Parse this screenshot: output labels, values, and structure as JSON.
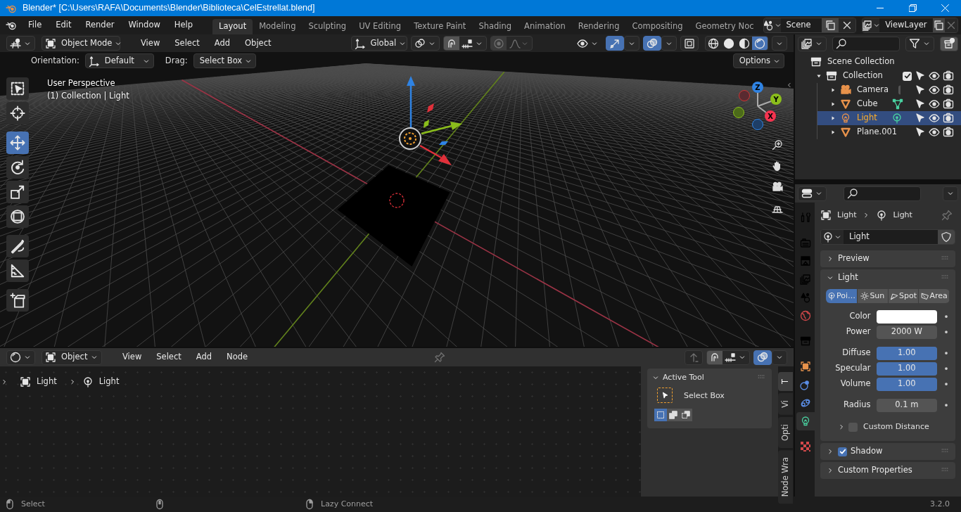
{
  "window": {
    "title": "Blender* [C:\\Users\\RAFA\\Documents\\Blender\\Biblioteca\\CelEstrellat.blend]"
  },
  "menu": [
    "File",
    "Edit",
    "Render",
    "Window",
    "Help"
  ],
  "workspaces": [
    {
      "label": "Layout",
      "selected": true
    },
    {
      "label": "Modeling",
      "selected": false
    },
    {
      "label": "Sculpting",
      "selected": false
    },
    {
      "label": "UV Editing",
      "selected": false
    },
    {
      "label": "Texture Paint",
      "selected": false
    },
    {
      "label": "Shading",
      "selected": false
    },
    {
      "label": "Animation",
      "selected": false
    },
    {
      "label": "Rendering",
      "selected": false
    },
    {
      "label": "Compositing",
      "selected": false
    },
    {
      "label": "Geometry Noc",
      "selected": false
    }
  ],
  "scene": "Scene",
  "view_layer": "ViewLayer",
  "viewport": {
    "mode": "Object Mode",
    "menus": [
      "View",
      "Select",
      "Add",
      "Object"
    ],
    "transform_orientation": "Global",
    "toggles": [
      {
        "kind": "gizmo",
        "on": true
      },
      {
        "kind": "overlay",
        "on": true
      },
      {
        "kind": "xray",
        "on": false
      }
    ],
    "shading": [
      {
        "kind": "wireframe",
        "selected": false
      },
      {
        "kind": "solid",
        "selected": false
      },
      {
        "kind": "material",
        "selected": false
      },
      {
        "kind": "rendered",
        "selected": true
      }
    ],
    "tool_settings": {
      "orientation_label": "Orientation:",
      "orientation": "Default",
      "drag_label": "Drag:",
      "drag": "Select Box",
      "options": "Options"
    },
    "overlay_text": [
      "User Perspective",
      "(1) Collection | Light"
    ],
    "tools": [
      {
        "kind": "select_box",
        "selected": false
      },
      {
        "kind": "cursor",
        "selected": false
      },
      {
        "kind": "move",
        "selected": true
      },
      {
        "kind": "rotate",
        "selected": false
      },
      {
        "kind": "scale",
        "selected": false
      },
      {
        "kind": "transform",
        "selected": false
      },
      {
        "kind": "annotate",
        "selected": false
      },
      {
        "kind": "measure",
        "selected": false
      },
      {
        "kind": "add_cube",
        "selected": false
      }
    ],
    "gizmo_axes": [
      "Z",
      "Y",
      "X"
    ]
  },
  "node_editor": {
    "data_type": "Object",
    "menus": [
      "View",
      "Select",
      "Add",
      "Node"
    ],
    "breadcrumb": [
      "Light",
      "Light"
    ],
    "active_tool": {
      "title": "Active Tool",
      "tool": "Select Box",
      "modes": [
        {
          "kind": "new",
          "selected": true
        },
        {
          "kind": "extend",
          "selected": false
        },
        {
          "kind": "subtract",
          "selected": false
        }
      ]
    },
    "sidebar_tabs": [
      {
        "label": "T",
        "selected": true
      },
      {
        "label": "Vi",
        "selected": false
      },
      {
        "label": "Opti",
        "selected": false
      },
      {
        "label": "Node Wra",
        "selected": false
      }
    ]
  },
  "outliner": {
    "root": "Scene Collection",
    "collections": [
      {
        "label": "Collection",
        "checked": true,
        "expanded": true,
        "children": [
          {
            "label": "Camera",
            "kind": "camera",
            "selected": false,
            "expanded": false,
            "data_visible": true
          },
          {
            "label": "Cube",
            "kind": "mesh",
            "selected": false,
            "expanded": false,
            "data_visible": true
          },
          {
            "label": "Light",
            "kind": "light",
            "selected": true,
            "expanded": false,
            "data_visible": true
          },
          {
            "label": "Plane.001",
            "kind": "mesh",
            "selected": false,
            "expanded": false,
            "data_visible": false
          }
        ]
      }
    ]
  },
  "properties": {
    "tab_groups": [
      [
        {
          "kind": "tool",
          "selected": false
        }
      ],
      [
        {
          "kind": "render",
          "selected": false
        },
        {
          "kind": "output",
          "selected": false
        },
        {
          "kind": "view_layer",
          "selected": false
        },
        {
          "kind": "scene",
          "selected": false
        },
        {
          "kind": "world",
          "selected": false
        }
      ],
      [
        {
          "kind": "collection",
          "selected": false
        }
      ],
      [
        {
          "kind": "object",
          "selected": false
        },
        {
          "kind": "physics",
          "selected": false
        },
        {
          "kind": "constraints",
          "selected": false
        },
        {
          "kind": "light",
          "selected": true
        }
      ],
      [
        {
          "kind": "texture",
          "selected": false
        }
      ]
    ],
    "breadcrumb": [
      "Light",
      "Light"
    ],
    "datablock": "Light",
    "panels": [
      {
        "title": "Preview",
        "expanded": false
      },
      {
        "title": "Light",
        "expanded": true,
        "light_types": [
          {
            "kind": "point",
            "label": "Poi…",
            "selected": true
          },
          {
            "kind": "sun",
            "label": "Sun",
            "selected": false
          },
          {
            "kind": "spot",
            "label": "Spot",
            "selected": false
          },
          {
            "kind": "area",
            "label": "Area",
            "selected": false
          }
        ],
        "field_groups": [
          [
            {
              "label": "Color",
              "kind": "color",
              "color": "#ffffff"
            },
            {
              "label": "Power",
              "kind": "number",
              "value": "2000 W"
            }
          ],
          [
            {
              "label": "Diffuse",
              "kind": "slider",
              "value": "1.00",
              "level": 1
            },
            {
              "label": "Specular",
              "kind": "slider",
              "value": "1.00",
              "level": 1
            },
            {
              "label": "Volume",
              "kind": "slider",
              "value": "1.00",
              "level": 1
            }
          ],
          [
            {
              "label": "Radius",
              "kind": "number",
              "value": "0.1 m"
            }
          ]
        ],
        "subpanels": [
          {
            "title": "Custom Distance",
            "expanded": false,
            "checked": false
          }
        ]
      },
      {
        "title": "Shadow",
        "expanded": false,
        "checked": true
      },
      {
        "title": "Custom Properties",
        "expanded": false
      }
    ]
  },
  "status_bar": {
    "hints": [
      {
        "kind": "left",
        "label": "Select"
      },
      {
        "kind": "middle"
      },
      {
        "kind": "right",
        "label": "Lazy Connect"
      }
    ],
    "version": "3.2.0"
  }
}
